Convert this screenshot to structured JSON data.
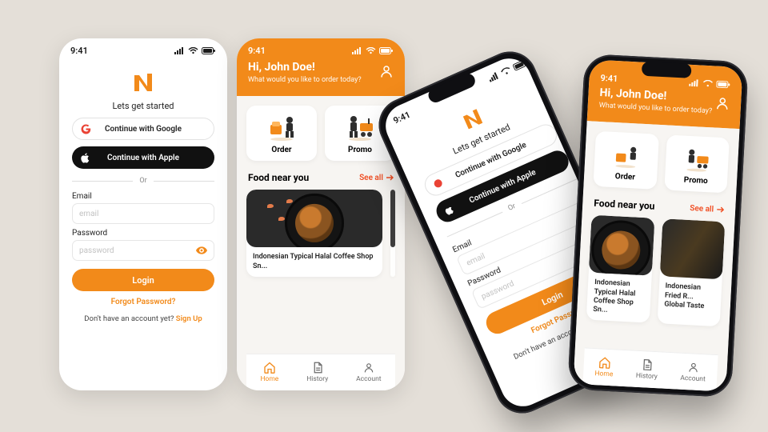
{
  "status": {
    "time": "9:41"
  },
  "accent": "#f28a1a",
  "login": {
    "lets_started": "Lets get started",
    "google": "Continue with Google",
    "apple": "Continue with Apple",
    "or": "Or",
    "email_label": "Email",
    "email_placeholder": "email",
    "password_label": "Password",
    "password_placeholder": "password",
    "login_btn": "Login",
    "forgot": "Forgot Password?",
    "no_account_prefix": "Don't have an account yet? ",
    "signup": "Sign Up"
  },
  "home": {
    "greeting": "Hi, John Doe!",
    "subtitle": "What would you like to order today?",
    "actions": [
      {
        "id": "order",
        "label": "Order"
      },
      {
        "id": "promo",
        "label": "Promo"
      }
    ],
    "food_near_you": "Food near you",
    "see_all": "See all",
    "cards": [
      {
        "title": "Indonesian Typical Halal Coffee Shop Sn..."
      },
      {
        "title": "Indonesian Fried R... Global Taste"
      }
    ],
    "tabs": [
      {
        "id": "home",
        "label": "Home",
        "active": true
      },
      {
        "id": "history",
        "label": "History",
        "active": false
      },
      {
        "id": "account",
        "label": "Account",
        "active": false
      }
    ]
  }
}
